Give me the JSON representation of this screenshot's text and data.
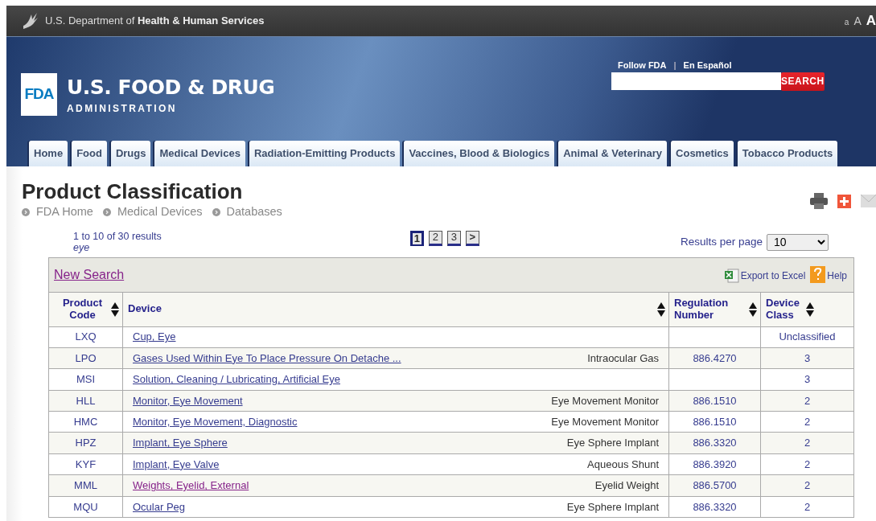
{
  "top_bar": {
    "agency": "U.S. Department of ",
    "agency_bold": "Health & Human Services",
    "text_sizes": [
      "a",
      "A",
      "A"
    ]
  },
  "header": {
    "logo_mark": "FDA",
    "logo_title": "U.S. FOOD & DRUG",
    "logo_subtitle": "ADMINISTRATION",
    "links": [
      "Follow FDA",
      "En Español"
    ],
    "link_separator": "|",
    "search_button": "SEARCH"
  },
  "nav_tabs": [
    {
      "label": "Home"
    },
    {
      "label": "Food"
    },
    {
      "label": "Drugs"
    },
    {
      "label": "Medical Devices"
    },
    {
      "label": "Radiation-Emitting Products"
    },
    {
      "label": "Vaccines, Blood & Biologics"
    },
    {
      "label": "Animal & Veterinary"
    },
    {
      "label": "Cosmetics"
    },
    {
      "label": "Tobacco Products"
    }
  ],
  "page": {
    "title": "Product Classification",
    "breadcrumb": [
      "FDA Home",
      "Medical Devices",
      "Databases"
    ]
  },
  "results": {
    "summary": "1 to 10 of 30 results",
    "query": "eye",
    "pages": [
      {
        "label": "1",
        "selected": true
      },
      {
        "label": "2",
        "selected": false
      },
      {
        "label": "3",
        "selected": false
      },
      {
        "label": ">",
        "selected": false
      }
    ],
    "per_page_label": "Results per page",
    "per_page": "10"
  },
  "toolbar": {
    "new_search": "New Search",
    "new_search_visited": true,
    "export": "Export to Excel",
    "help": "Help"
  },
  "table": {
    "columns": [
      "Product Code",
      "Device",
      "Regulation Number",
      "Device Class"
    ],
    "rows": [
      {
        "code": "LXQ",
        "device": "Cup, Eye",
        "visited": false,
        "device_type": "",
        "regulation": "",
        "device_class": "Unclassified"
      },
      {
        "code": "LPO",
        "device": "Gases Used Within Eye To Place Pressure On Detache ...",
        "visited": false,
        "device_type": "Intraocular Gas",
        "regulation": "886.4270",
        "device_class": "3"
      },
      {
        "code": "MSI",
        "device": "Solution, Cleaning / Lubricating, Artificial Eye",
        "visited": false,
        "device_type": "",
        "regulation": "",
        "device_class": "3"
      },
      {
        "code": "HLL",
        "device": "Monitor, Eye Movement",
        "visited": false,
        "device_type": "Eye Movement Monitor",
        "regulation": "886.1510",
        "device_class": "2"
      },
      {
        "code": "HMC",
        "device": "Monitor, Eye Movement, Diagnostic",
        "visited": false,
        "device_type": "Eye Movement Monitor",
        "regulation": "886.1510",
        "device_class": "2"
      },
      {
        "code": "HPZ",
        "device": "Implant, Eye Sphere",
        "visited": false,
        "device_type": "Eye Sphere Implant",
        "regulation": "886.3320",
        "device_class": "2"
      },
      {
        "code": "KYF",
        "device": "Implant, Eye Valve",
        "visited": false,
        "device_type": "Aqueous Shunt",
        "regulation": "886.3920",
        "device_class": "2"
      },
      {
        "code": "MML",
        "device": "Weights, Eyelid, External",
        "visited": true,
        "device_type": "Eyelid Weight",
        "regulation": "886.5700",
        "device_class": "2"
      },
      {
        "code": "MQU",
        "device": "Ocular Peg",
        "visited": false,
        "device_type": "Eye Sphere Implant",
        "regulation": "886.3320",
        "device_class": "2"
      }
    ]
  }
}
